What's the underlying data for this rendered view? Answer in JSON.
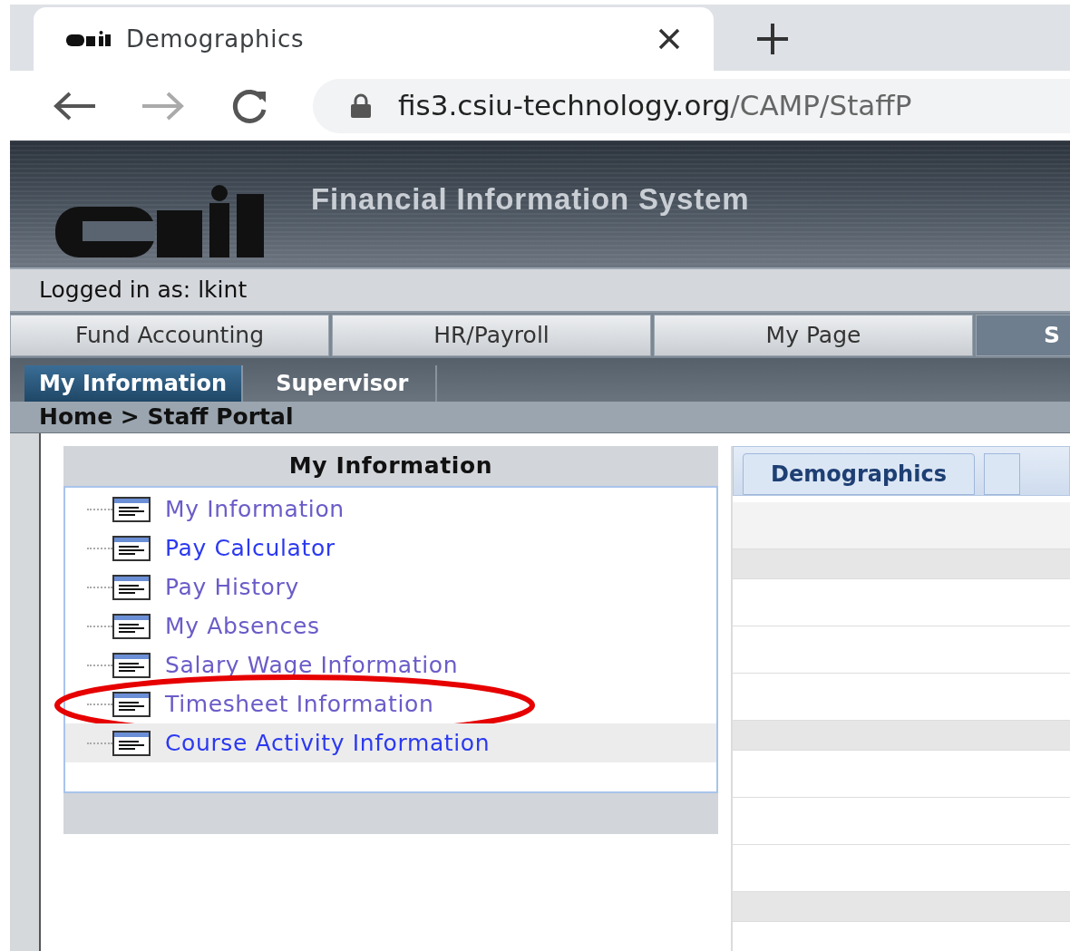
{
  "browser": {
    "tab": {
      "title": "Demographics"
    },
    "address": {
      "host": "fis3.csiu-technology.org",
      "path": "/CAMP/StaffP"
    }
  },
  "app": {
    "title": "Financial Information System",
    "login": "Logged in as: lkint",
    "main_tabs": [
      {
        "label": "Fund Accounting",
        "selected": false
      },
      {
        "label": "HR/Payroll",
        "selected": false
      },
      {
        "label": "My Page",
        "selected": false
      },
      {
        "label": "S",
        "selected": true
      }
    ],
    "sub_tabs": [
      {
        "label": "My Information",
        "selected": true
      },
      {
        "label": "Supervisor",
        "selected": false
      }
    ],
    "breadcrumb": "Home > Staff Portal",
    "menu_panel": {
      "title": "My Information",
      "items": [
        {
          "label": "My Information",
          "visited": true,
          "highlighted": false,
          "circled": false
        },
        {
          "label": "Pay Calculator",
          "visited": false,
          "highlighted": false,
          "circled": false
        },
        {
          "label": "Pay History",
          "visited": true,
          "highlighted": false,
          "circled": false
        },
        {
          "label": "My Absences",
          "visited": true,
          "highlighted": false,
          "circled": false
        },
        {
          "label": "Salary Wage Information",
          "visited": true,
          "highlighted": false,
          "circled": false
        },
        {
          "label": "Timesheet Information",
          "visited": true,
          "highlighted": false,
          "circled": true
        },
        {
          "label": "Course Activity Information",
          "visited": false,
          "highlighted": true,
          "circled": false
        }
      ]
    },
    "detail_panel": {
      "tabs": [
        {
          "label": "Demographics",
          "selected": true
        }
      ]
    }
  }
}
